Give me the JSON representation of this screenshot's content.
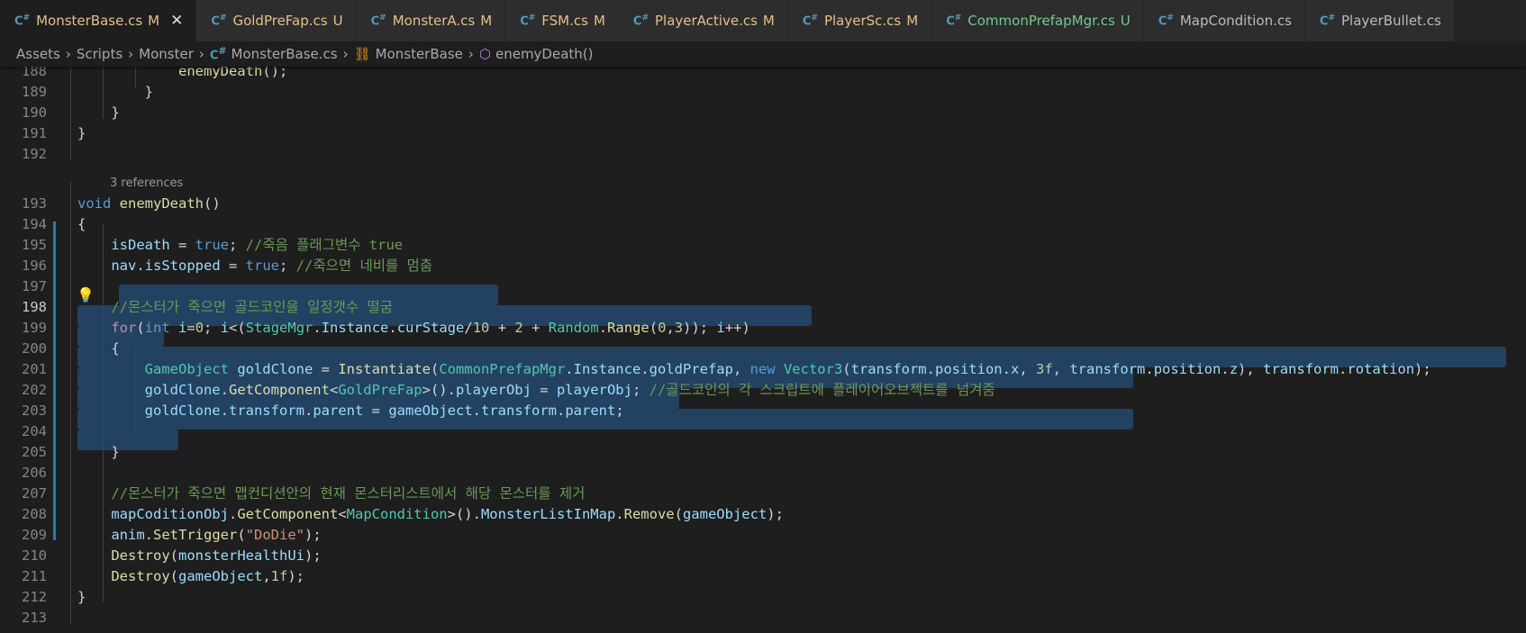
{
  "tabs": [
    {
      "name": "MonsterBase.cs",
      "badge": "M",
      "status": "m",
      "active": true,
      "close": "✕"
    },
    {
      "name": "GoldPreFap.cs",
      "badge": "U",
      "status": "m",
      "active": false
    },
    {
      "name": "MonsterA.cs",
      "badge": "M",
      "status": "m",
      "active": false
    },
    {
      "name": "FSM.cs",
      "badge": "M",
      "status": "m",
      "active": false
    },
    {
      "name": "PlayerActive.cs",
      "badge": "M",
      "status": "m",
      "active": false
    },
    {
      "name": "PlayerSc.cs",
      "badge": "M",
      "status": "m",
      "active": false
    },
    {
      "name": "CommonPrefapMgr.cs",
      "badge": "U",
      "status": "u",
      "active": false
    },
    {
      "name": "MapCondition.cs",
      "badge": "",
      "status": "plain",
      "active": false
    },
    {
      "name": "PlayerBullet.cs",
      "badge": "",
      "status": "plain",
      "active": false
    }
  ],
  "breadcrumb": [
    "Assets",
    "Scripts",
    "Monster",
    "MonsterBase.cs",
    "MonsterBase",
    "enemyDeath()"
  ],
  "codelens": "3 references",
  "lines": [
    {
      "n": "188",
      "t": [
        [
          "fn",
          "            enemyDeath"
        ],
        [
          "pu",
          "();"
        ]
      ]
    },
    {
      "n": "189",
      "t": [
        [
          "pu",
          "        }"
        ]
      ]
    },
    {
      "n": "190",
      "t": [
        [
          "pu",
          "    }"
        ]
      ]
    },
    {
      "n": "191",
      "t": [
        [
          "pu",
          "}"
        ]
      ]
    },
    {
      "n": "192",
      "t": []
    },
    {
      "n": "193",
      "t": [
        [
          "kw",
          "void "
        ],
        [
          "fn",
          "enemyDeath"
        ],
        [
          "pu",
          "()"
        ]
      ]
    },
    {
      "n": "194",
      "t": [
        [
          "pu",
          "{"
        ]
      ]
    },
    {
      "n": "195",
      "t": [
        [
          "vr",
          "    isDeath"
        ],
        [
          "pu",
          " = "
        ],
        [
          "kw",
          "true"
        ],
        [
          "pu",
          "; "
        ],
        [
          "cm",
          "//죽음 플래그변수 true"
        ]
      ]
    },
    {
      "n": "196",
      "t": [
        [
          "vr",
          "    nav"
        ],
        [
          "pu",
          "."
        ],
        [
          "vr",
          "isStopped"
        ],
        [
          "pu",
          " = "
        ],
        [
          "kw",
          "true"
        ],
        [
          "pu",
          "; "
        ],
        [
          "cm",
          "//죽으면 네비를 멈춤"
        ]
      ]
    },
    {
      "n": "197",
      "t": []
    },
    {
      "n": "198",
      "t": [
        [
          "cm",
          "    //몬스터가 죽으면 골드코인을 일정갯수 떨굼"
        ]
      ]
    },
    {
      "n": "199",
      "t": [
        [
          "ctl",
          "    for"
        ],
        [
          "pu",
          "("
        ],
        [
          "kw",
          "int "
        ],
        [
          "vr",
          "i"
        ],
        [
          "pu",
          "="
        ],
        [
          "nu",
          "0"
        ],
        [
          "pu",
          "; "
        ],
        [
          "vr",
          "i"
        ],
        [
          "pu",
          "<("
        ],
        [
          "ty",
          "StageMgr"
        ],
        [
          "pu",
          "."
        ],
        [
          "vr",
          "Instance"
        ],
        [
          "pu",
          "."
        ],
        [
          "vr",
          "curStage"
        ],
        [
          "pu",
          "/"
        ],
        [
          "nu",
          "10"
        ],
        [
          "pu",
          " + "
        ],
        [
          "nu",
          "2"
        ],
        [
          "pu",
          " + "
        ],
        [
          "ty",
          "Random"
        ],
        [
          "pu",
          "."
        ],
        [
          "fn",
          "Range"
        ],
        [
          "pu",
          "("
        ],
        [
          "nu",
          "0"
        ],
        [
          "pu",
          ","
        ],
        [
          "nu",
          "3"
        ],
        [
          "pu",
          ")); "
        ],
        [
          "vr",
          "i"
        ],
        [
          "pu",
          "++)"
        ]
      ]
    },
    {
      "n": "200",
      "t": [
        [
          "pu",
          "    {"
        ]
      ]
    },
    {
      "n": "201",
      "t": [
        [
          "ty",
          "        GameObject "
        ],
        [
          "vr",
          "goldClone"
        ],
        [
          "pu",
          " = "
        ],
        [
          "fn",
          "Instantiate"
        ],
        [
          "pu",
          "("
        ],
        [
          "ty",
          "CommonPrefapMgr"
        ],
        [
          "pu",
          "."
        ],
        [
          "vr",
          "Instance"
        ],
        [
          "pu",
          "."
        ],
        [
          "vr",
          "goldPrefap"
        ],
        [
          "pu",
          ", "
        ],
        [
          "kw",
          "new "
        ],
        [
          "ty",
          "Vector3"
        ],
        [
          "pu",
          "("
        ],
        [
          "vr",
          "transform"
        ],
        [
          "pu",
          "."
        ],
        [
          "vr",
          "position"
        ],
        [
          "pu",
          "."
        ],
        [
          "vr",
          "x"
        ],
        [
          "pu",
          ", "
        ],
        [
          "nu",
          "3f"
        ],
        [
          "pu",
          ", "
        ],
        [
          "vr",
          "transform"
        ],
        [
          "pu",
          "."
        ],
        [
          "vr",
          "position"
        ],
        [
          "pu",
          "."
        ],
        [
          "vr",
          "z"
        ],
        [
          "pu",
          "), "
        ],
        [
          "vr",
          "transform"
        ],
        [
          "pu",
          "."
        ],
        [
          "vr",
          "rotation"
        ],
        [
          "pu",
          ");"
        ]
      ]
    },
    {
      "n": "202",
      "t": [
        [
          "vr",
          "        goldClone"
        ],
        [
          "pu",
          "."
        ],
        [
          "fn",
          "GetComponent"
        ],
        [
          "pu",
          "<"
        ],
        [
          "ty",
          "GoldPreFap"
        ],
        [
          "pu",
          ">()."
        ],
        [
          "vr",
          "playerObj"
        ],
        [
          "pu",
          " = "
        ],
        [
          "vr",
          "playerObj"
        ],
        [
          "pu",
          "; "
        ],
        [
          "cm",
          "//골드코인의 각 스크립트에 플레이어오브젝트를 넘겨줌"
        ]
      ]
    },
    {
      "n": "203",
      "t": [
        [
          "vr",
          "        goldClone"
        ],
        [
          "pu",
          "."
        ],
        [
          "vr",
          "transform"
        ],
        [
          "pu",
          "."
        ],
        [
          "vr",
          "parent"
        ],
        [
          "pu",
          " = "
        ],
        [
          "vr",
          "gameObject"
        ],
        [
          "pu",
          "."
        ],
        [
          "vr",
          "transform"
        ],
        [
          "pu",
          "."
        ],
        [
          "vr",
          "parent"
        ],
        [
          "pu",
          ";"
        ]
      ]
    },
    {
      "n": "204",
      "t": []
    },
    {
      "n": "205",
      "t": [
        [
          "pu",
          "    }"
        ]
      ]
    },
    {
      "n": "206",
      "t": []
    },
    {
      "n": "207",
      "t": [
        [
          "cm",
          "    //몬스터가 죽으면 맵컨디션안의 현재 몬스터리스트에서 해당 몬스터를 제거"
        ]
      ]
    },
    {
      "n": "208",
      "t": [
        [
          "vr",
          "    mapCoditionObj"
        ],
        [
          "pu",
          "."
        ],
        [
          "fn",
          "GetComponent"
        ],
        [
          "pu",
          "<"
        ],
        [
          "ty",
          "MapCondition"
        ],
        [
          "pu",
          ">()."
        ],
        [
          "vr",
          "MonsterListInMap"
        ],
        [
          "pu",
          "."
        ],
        [
          "fn",
          "Remove"
        ],
        [
          "pu",
          "("
        ],
        [
          "vr",
          "gameObject"
        ],
        [
          "pu",
          ");"
        ]
      ]
    },
    {
      "n": "209",
      "t": [
        [
          "vr",
          "    anim"
        ],
        [
          "pu",
          "."
        ],
        [
          "fn",
          "SetTrigger"
        ],
        [
          "pu",
          "("
        ],
        [
          "st",
          "\"DoDie\""
        ],
        [
          "pu",
          ");"
        ]
      ]
    },
    {
      "n": "210",
      "t": [
        [
          "fn",
          "    Destroy"
        ],
        [
          "pu",
          "("
        ],
        [
          "vr",
          "monsterHealthUi"
        ],
        [
          "pu",
          ");"
        ]
      ]
    },
    {
      "n": "211",
      "t": [
        [
          "fn",
          "    Destroy"
        ],
        [
          "pu",
          "("
        ],
        [
          "vr",
          "gameObject"
        ],
        [
          "pu",
          ","
        ],
        [
          "nu",
          "1f"
        ],
        [
          "pu",
          ");"
        ]
      ]
    },
    {
      "n": "212",
      "t": [
        [
          "pu",
          "}"
        ]
      ]
    },
    {
      "n": "213",
      "t": []
    }
  ],
  "colors": {
    "accent": "#1b81a8",
    "selection": "#264f78",
    "background": "#1e1e1e"
  }
}
